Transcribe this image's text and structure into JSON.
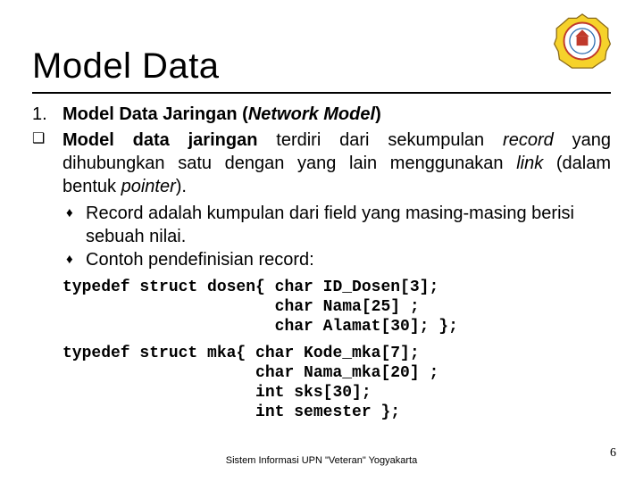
{
  "logo_name": "upn-veteran-yogyakarta-seal",
  "title": "Model Data",
  "section": {
    "number": "1.",
    "heading_plain": "Model Data Jaringan (",
    "heading_italic": "Network Model",
    "heading_close": ")",
    "bullet_symbol": "❑",
    "body_term": "Model data jaringan",
    "body_part1": " terdiri dari sekumpulan ",
    "body_italic1": "record",
    "body_part2": " yang dihubungkan satu dengan yang lain menggunakan ",
    "body_italic2": "link",
    "body_part3": " (dalam bentuk ",
    "body_italic3": "pointer",
    "body_part4": ").",
    "sub_bullet": "♦",
    "sub1": "Record adalah kumpulan dari field yang masing-masing berisi sebuah nilai.",
    "sub2": "Contoh pendefinisian record:"
  },
  "code": {
    "block1": "typedef struct dosen{ char ID_Dosen[3];\n                      char Nama[25] ;\n                      char Alamat[30]; };",
    "block2": "typedef struct mka{ char Kode_mka[7];\n                    char Nama_mka[20] ;\n                    int sks[30];\n                    int semester };"
  },
  "footer": "Sistem Informasi UPN \"Veteran\" Yogyakarta",
  "page_number": "6"
}
